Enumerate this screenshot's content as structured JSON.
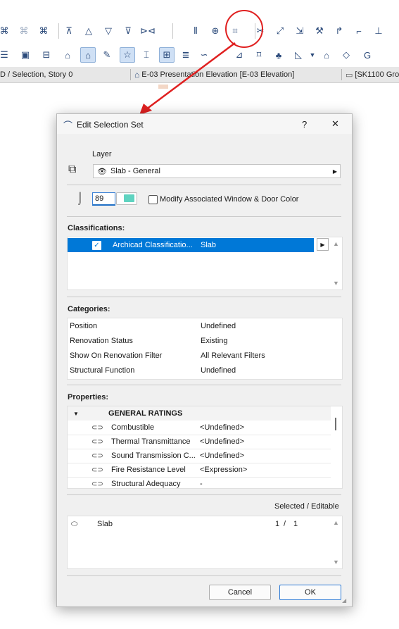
{
  "tabs": [
    {
      "label": "D / Selection, Story 0"
    },
    {
      "label": "E-03 Presentation Elevation [E-03 Elevation]"
    },
    {
      "label": "[SK1100 Gro"
    }
  ],
  "dialog": {
    "title": "Edit Selection Set",
    "help": "?",
    "close": "✕",
    "layer": {
      "label": "Layer",
      "value": "Slab - General"
    },
    "pen": {
      "value": "89",
      "modify_label": "Modify Associated Window & Door Color"
    },
    "classifications": {
      "header": "Classifications:",
      "rows": [
        {
          "name": "Archicad Classificatio...",
          "value": "Slab"
        }
      ]
    },
    "categories": {
      "header": "Categories:",
      "rows": [
        {
          "name": "Position",
          "value": "Undefined"
        },
        {
          "name": "Renovation Status",
          "value": "Existing"
        },
        {
          "name": "Show On Renovation Filter",
          "value": "All Relevant Filters"
        },
        {
          "name": "Structural Function",
          "value": "Undefined"
        }
      ]
    },
    "properties": {
      "header": "Properties:",
      "group": "GENERAL RATINGS",
      "rows": [
        {
          "name": "Combustible",
          "value": "<Undefined>"
        },
        {
          "name": "Thermal Transmittance",
          "value": "<Undefined>"
        },
        {
          "name": "Sound Transmission C...",
          "value": "<Undefined>"
        },
        {
          "name": "Fire Resistance Level",
          "value": "<Expression>"
        },
        {
          "name": "Structural Adequacy",
          "value": "-"
        }
      ]
    },
    "selection": {
      "header": "Selected / Editable",
      "rows": [
        {
          "name": "Slab",
          "selected": "1",
          "sep": "/",
          "editable": "1"
        }
      ]
    },
    "cancel_label": "Cancel",
    "ok_label": "OK"
  },
  "colors": {
    "accent": "#0078d7",
    "annotation": "#e02020",
    "pen_swatch": "#5fd3c0"
  }
}
